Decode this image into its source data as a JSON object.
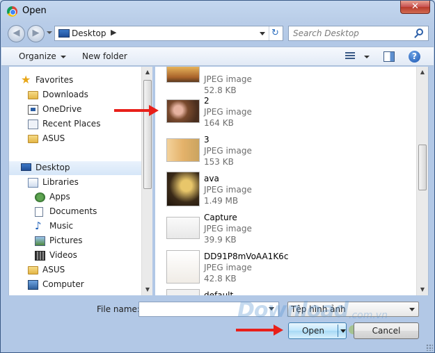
{
  "window": {
    "title": "Open",
    "close_label": "✕"
  },
  "nav": {
    "back_label": "◀",
    "forward_label": "▶",
    "address": {
      "location": "Desktop",
      "separator": "▶"
    },
    "refresh_label": "↻",
    "search": {
      "placeholder": "Search Desktop"
    }
  },
  "toolbar": {
    "organize_label": "Organize",
    "new_folder_label": "New folder",
    "help_label": "?"
  },
  "sidebar": {
    "items": [
      {
        "label": "Favorites",
        "icon": "star-icon"
      },
      {
        "label": "Downloads",
        "icon": "downloads-folder-icon"
      },
      {
        "label": "OneDrive",
        "icon": "onedrive-icon"
      },
      {
        "label": "Recent Places",
        "icon": "recent-places-icon"
      },
      {
        "label": "ASUS",
        "icon": "folder-icon"
      },
      {
        "label": "Desktop",
        "icon": "desktop-icon"
      },
      {
        "label": "Libraries",
        "icon": "libraries-icon"
      },
      {
        "label": "Apps",
        "icon": "apps-icon"
      },
      {
        "label": "Documents",
        "icon": "documents-icon"
      },
      {
        "label": "Music",
        "icon": "music-icon"
      },
      {
        "label": "Pictures",
        "icon": "pictures-icon"
      },
      {
        "label": "Videos",
        "icon": "videos-icon"
      },
      {
        "label": "ASUS",
        "icon": "user-folder-icon"
      },
      {
        "label": "Computer",
        "icon": "computer-icon"
      }
    ]
  },
  "files": [
    {
      "name": "",
      "type": "JPEG image",
      "size": "52.8 KB"
    },
    {
      "name": "2",
      "type": "JPEG image",
      "size": "164 KB"
    },
    {
      "name": "3",
      "type": "JPEG image",
      "size": "153 KB"
    },
    {
      "name": "ava",
      "type": "JPEG image",
      "size": "1.49 MB"
    },
    {
      "name": "Capture",
      "type": "JPEG image",
      "size": "39.9 KB"
    },
    {
      "name": "DD91P8mVoAA1K6c",
      "type": "JPEG image",
      "size": "42.8 KB"
    },
    {
      "name": "default",
      "type": "",
      "size": ""
    }
  ],
  "bottom": {
    "file_name_label": "File name:",
    "file_name_value": "",
    "file_type_value": "Tệp hình ảnh",
    "open_label": "Open",
    "cancel_label": "Cancel"
  },
  "watermark": {
    "text": "Download",
    "sub": ".com.vn"
  },
  "colors": {
    "accent": "#3c7fb1",
    "arrow": "#e8201a"
  }
}
